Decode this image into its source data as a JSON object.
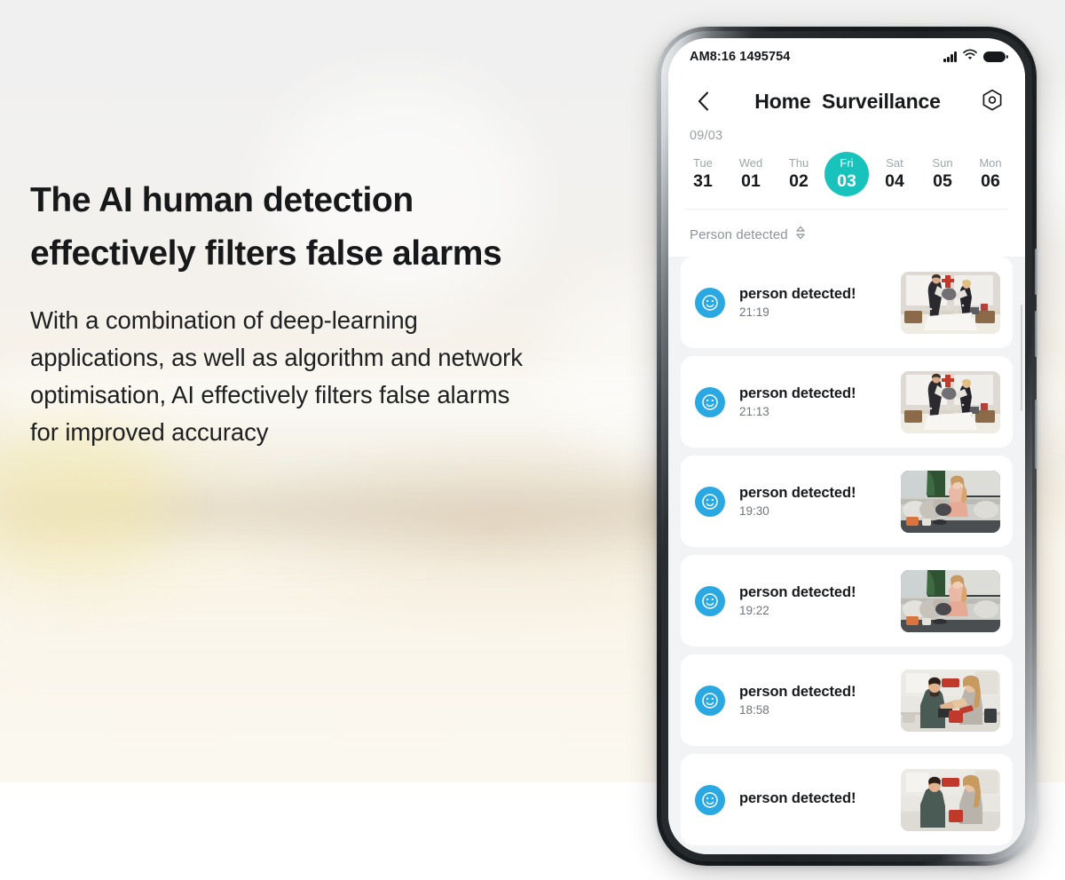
{
  "marketing": {
    "headline_lines": [
      "The AI human detection",
      "effectively filters false alarms"
    ],
    "body_lines": [
      "With a combination of deep-learning",
      "applications, as well as algorithm and network",
      "optimisation, AI effectively filters false alarms",
      "for improved accuracy"
    ]
  },
  "colors": {
    "accent_teal": "#17c3bb",
    "avatar_blue": "#2aa8e2",
    "list_background": "#f2f3f5",
    "text_primary": "#17191c",
    "text_muted": "#8e9297"
  },
  "phone": {
    "status_bar": {
      "time_text": "AM8:16 1495754",
      "signal_icon": "signal-bars-icon",
      "wifi_icon": "wifi-icon",
      "battery_icon": "battery-icon"
    },
    "header": {
      "back_icon": "chevron-left-icon",
      "title": "Home  Surveillance",
      "settings_icon": "hex-settings-icon"
    },
    "date_strip": {
      "month_label": "09/03",
      "days": [
        {
          "dow": "Tue",
          "num": "31",
          "selected": false
        },
        {
          "dow": "Wed",
          "num": "01",
          "selected": false
        },
        {
          "dow": "Thu",
          "num": "02",
          "selected": false
        },
        {
          "dow": "Fri",
          "num": "03",
          "selected": true
        },
        {
          "dow": "Sat",
          "num": "04",
          "selected": false
        },
        {
          "dow": "Sun",
          "num": "05",
          "selected": false
        },
        {
          "dow": "Mon",
          "num": "06",
          "selected": false
        }
      ]
    },
    "filter": {
      "label": "Person detected",
      "sort_icon": "sort-chevron-icon"
    },
    "events": [
      {
        "title": "person detected!",
        "time": "21:19",
        "avatar_icon": "smiley-face-icon",
        "thumbnail": "pillow-fight-bedroom"
      },
      {
        "title": "person detected!",
        "time": "21:13",
        "avatar_icon": "smiley-face-icon",
        "thumbnail": "pillow-fight-bedroom"
      },
      {
        "title": "person detected!",
        "time": "19:30",
        "avatar_icon": "smiley-face-icon",
        "thumbnail": "woman-dog-couch"
      },
      {
        "title": "person detected!",
        "time": "19:22",
        "avatar_icon": "smiley-face-icon",
        "thumbnail": "woman-dog-couch"
      },
      {
        "title": "person detected!",
        "time": "18:58",
        "avatar_icon": "smiley-face-icon",
        "thumbnail": "couple-kitchen"
      },
      {
        "title": "person detected!",
        "time": "",
        "avatar_icon": "smiley-face-icon",
        "thumbnail": "couple-kitchen"
      }
    ]
  }
}
